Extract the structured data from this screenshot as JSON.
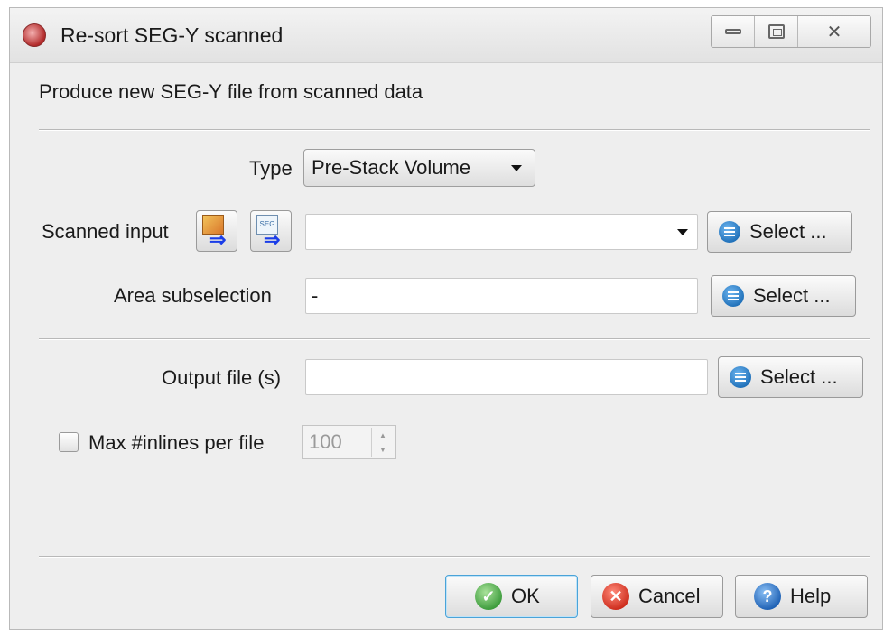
{
  "window": {
    "title": "Re-sort SEG-Y scanned",
    "controls": [
      "minimize-icon",
      "maximize-icon",
      "close-icon"
    ]
  },
  "heading": "Produce new SEG-Y file from scanned data",
  "type": {
    "label": "Type",
    "value": "Pre-Stack Volume"
  },
  "scanned_input": {
    "label": "Scanned input",
    "value": "",
    "select_label": "Select ..."
  },
  "area_subselection": {
    "label": "Area subselection",
    "value": "-",
    "select_label": "Select ..."
  },
  "output_file": {
    "label": "Output file (s)",
    "value": "",
    "select_label": "Select ..."
  },
  "max_inlines": {
    "label": "Max #inlines per file",
    "checked": false,
    "value": "100"
  },
  "footer": {
    "ok_label": "OK",
    "cancel_label": "Cancel",
    "help_label": "Help"
  }
}
